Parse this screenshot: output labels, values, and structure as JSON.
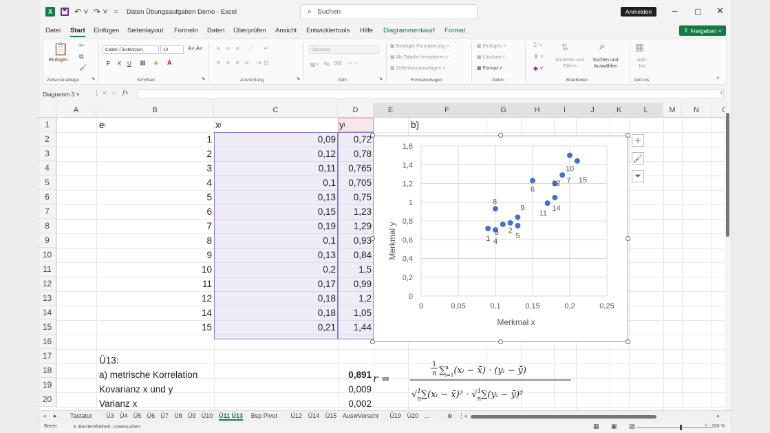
{
  "titlebar": {
    "document_title": "Daten Übungsaufgaben Demo  -  Excel",
    "search_placeholder": "Suchen",
    "signin_label": "Anmelden",
    "icons": [
      "excel-logo-icon",
      "save-icon",
      "undo-icon",
      "redo-icon",
      "customize-qat-icon",
      "minimize-icon",
      "restore-icon",
      "close-icon"
    ]
  },
  "menu": {
    "items": [
      "Datei",
      "Start",
      "Einfügen",
      "Seitenlayout",
      "Formeln",
      "Daten",
      "Überprüfen",
      "Ansicht",
      "Entwicklertools",
      "Hilfe",
      "Diagrammentwurf",
      "Format"
    ],
    "active": "Start",
    "share_label": "Freigeben"
  },
  "ribbon": {
    "clipboard": {
      "paste": "Einfügen",
      "label": "Zwischenablage"
    },
    "font": {
      "name": "Calibri (Textkörper)",
      "size": "10",
      "bold": "F",
      "italic": "K",
      "underline": "U",
      "label": "Schriftart"
    },
    "alignment": {
      "label": "Ausrichtung"
    },
    "number": {
      "format": "Standard",
      "percent": "%",
      "thousands": "000",
      "label": "Zahl"
    },
    "styles": {
      "conditional": "Bedingte Formatierung",
      "as_table": "Als Tabelle formatieren",
      "cell_styles": "Zellenformatvorlagen",
      "label": "Formatvorlagen"
    },
    "cells": {
      "insert": "Einfügen",
      "delete": "Löschen",
      "format": "Format",
      "label": "Zellen"
    },
    "editing": {
      "sort": "Sortieren und Filtern",
      "find": "Suchen und Auswählen",
      "label": "Bearbeiten"
    },
    "addins": {
      "button": "Add-Ins",
      "label": "Add-Ins"
    }
  },
  "formula_bar": {
    "name_box": "Diagramm 3",
    "fx": "fx",
    "content": ""
  },
  "columns": [
    "A",
    "B",
    "C",
    "D",
    "E",
    "F",
    "G",
    "H",
    "I",
    "J",
    "K",
    "L",
    "M",
    "N",
    "O"
  ],
  "rows": [
    "1",
    "2",
    "3",
    "4",
    "5",
    "6",
    "7",
    "8",
    "9",
    "10",
    "11",
    "12",
    "13",
    "14",
    "15",
    "16",
    "17",
    "18",
    "19",
    "20"
  ],
  "table": {
    "header_e": "e",
    "header_e_sub": "i",
    "header_x": "x",
    "header_x_sub": "i",
    "header_y": "y",
    "header_y_sub": "i",
    "e": [
      "1",
      "2",
      "3",
      "4",
      "5",
      "6",
      "7",
      "8",
      "9",
      "10",
      "11",
      "12",
      "14",
      "15"
    ],
    "x": [
      "0,09",
      "0,12",
      "0,11",
      "0,1",
      "0,13",
      "0,15",
      "0,19",
      "0,1",
      "0,13",
      "0,2",
      "0,17",
      "0,18",
      "0,18",
      "0,21"
    ],
    "y": [
      "0,72",
      "0,78",
      "0,765",
      "0,705",
      "0,75",
      "1,23",
      "1,29",
      "0,93",
      "0,84",
      "1,5",
      "0,99",
      "1,2",
      "1,05",
      "1,44"
    ]
  },
  "cells_text": {
    "e1_label": "b)",
    "a17": "Ü13:",
    "a18": "a) metrische Korrelation",
    "c18": "0,891",
    "a19": "Kovarianz x und y",
    "c19": "0,009",
    "a20": "Varianz x",
    "c20": "0,002"
  },
  "formula_text": {
    "lhs": "r =",
    "numerator": "1/n Σ(xᵢ − x̄)·(yᵢ − ȳ), i = 1…n",
    "denominator": "√(1/n Σ(xᵢ − x̄)²) · √(1/n Σ(yᵢ − ȳ)²), i = 1…n"
  },
  "chart_data": {
    "type": "scatter",
    "xlabel": "Merkmal x",
    "ylabel": "Merkmal y",
    "xlim": [
      0,
      0.25
    ],
    "ylim": [
      0,
      1.6
    ],
    "x_ticks": [
      "0",
      "0,05",
      "0,1",
      "0,15",
      "0,2",
      "0,25"
    ],
    "y_ticks": [
      "0",
      "0,2",
      "0,4",
      "0,6",
      "0,8",
      "1",
      "1,2",
      "1,4",
      "1,6"
    ],
    "grid": true,
    "marker_color": "#4472c4",
    "points": [
      {
        "x": 0.09,
        "y": 0.72,
        "label": "1"
      },
      {
        "x": 0.12,
        "y": 0.78,
        "label": "2"
      },
      {
        "x": 0.11,
        "y": 0.765,
        "label": "3"
      },
      {
        "x": 0.1,
        "y": 0.705,
        "label": "4"
      },
      {
        "x": 0.13,
        "y": 0.75,
        "label": "5"
      },
      {
        "x": 0.15,
        "y": 1.23,
        "label": "6"
      },
      {
        "x": 0.19,
        "y": 1.29,
        "label": "7"
      },
      {
        "x": 0.1,
        "y": 0.93,
        "label": "8"
      },
      {
        "x": 0.13,
        "y": 0.84,
        "label": "9"
      },
      {
        "x": 0.2,
        "y": 1.5,
        "label": "10"
      },
      {
        "x": 0.17,
        "y": 0.99,
        "label": "11"
      },
      {
        "x": 0.18,
        "y": 1.2,
        "label": "12"
      },
      {
        "x": 0.18,
        "y": 1.05,
        "label": "14"
      },
      {
        "x": 0.21,
        "y": 1.44,
        "label": "15"
      }
    ]
  },
  "chart_side_buttons": [
    "chart-elements-icon",
    "chart-styles-icon",
    "chart-filter-icon"
  ],
  "sheet_tabs": [
    "Tastatur",
    "Ü3",
    "Ü4",
    "Ü5",
    "Ü6",
    "Ü7",
    "Ü8",
    "Ü9",
    "Ü10",
    "Ü11 Ü13",
    "Bsp Pivot",
    "Ü12",
    "Ü14",
    "Ü15",
    "AuswVorschr",
    "Ü19",
    "Ü20",
    "..."
  ],
  "active_sheet": "Ü11 Ü13",
  "status": {
    "ready": "Bereit",
    "accessibility": "Barrierefreiheit: Untersuchen",
    "zoom": "160 %"
  }
}
